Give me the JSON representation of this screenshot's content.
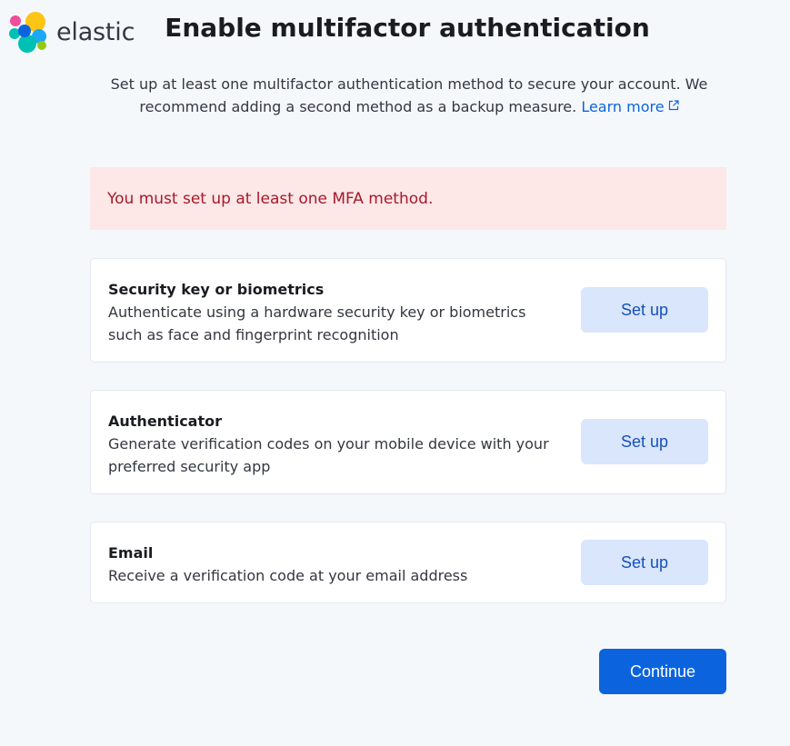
{
  "brand": {
    "logo_text": "elastic",
    "colors": {
      "yellow": "#fec514",
      "pink": "#f04e98",
      "teal": "#00bfb3",
      "blue": "#1ba9f5",
      "navy": "#0b64dd",
      "green": "#93c90e"
    }
  },
  "page": {
    "title": "Enable multifactor authentication",
    "subtitle": "Set up at least one multifactor authentication method to secure your account. We recommend adding a second method as a backup measure.",
    "learn_more": "Learn more",
    "learn_more_icon": "external-link-icon"
  },
  "error": {
    "message": "You must set up at least one MFA method."
  },
  "methods": [
    {
      "title": "Security key or biometrics",
      "description": "Authenticate using a hardware security key or biometrics such as face and fingerprint recognition",
      "button": "Set up"
    },
    {
      "title": "Authenticator",
      "description": "Generate verification codes on your mobile device with your preferred security app",
      "button": "Set up"
    },
    {
      "title": "Email",
      "description": "Receive a verification code at your email address",
      "button": "Set up"
    }
  ],
  "actions": {
    "continue": "Continue"
  },
  "theme": {
    "accent": "#0b64dd",
    "error_bg": "#fde7e7",
    "error_text": "#a8192b",
    "secondary_button_bg": "#d9e6fb",
    "secondary_button_text": "#1750ba"
  }
}
